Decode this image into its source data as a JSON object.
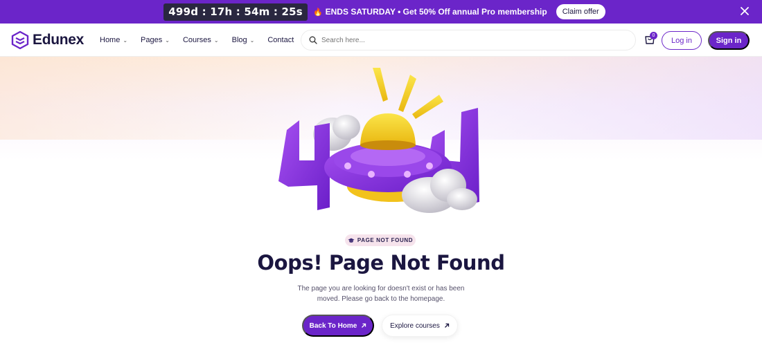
{
  "promo": {
    "countdown": "499d : 17h : 54m : 25s",
    "message": "ENDS SATURDAY • Get 50% Off annual Pro membership",
    "claim_label": "Claim offer"
  },
  "header": {
    "brand": "Edunex",
    "nav": [
      {
        "label": "Home",
        "has_dropdown": true
      },
      {
        "label": "Pages",
        "has_dropdown": true
      },
      {
        "label": "Courses",
        "has_dropdown": true
      },
      {
        "label": "Blog",
        "has_dropdown": true
      },
      {
        "label": "Contact",
        "has_dropdown": false
      }
    ],
    "search_placeholder": "Search here...",
    "cart_count": "0",
    "login_label": "Log in",
    "signin_label": "Sign in"
  },
  "hero": {
    "badge": "PAGE NOT FOUND",
    "title": "Oops! Page Not Found",
    "description": "The page you are looking for doesn't exist or has been moved. Please go back to the homepage.",
    "primary_button": "Back To Home",
    "secondary_button": "Explore courses"
  },
  "colors": {
    "brand_purple": "#6b25c9",
    "dark_text": "#1b1640",
    "countdown_bg": "#2a2740",
    "illustration_yellow": "#f3d02a"
  },
  "icons": [
    "fire-icon",
    "close-icon",
    "logo-icon",
    "chevron-down-icon",
    "search-icon",
    "cart-icon",
    "graduation-cap-icon",
    "arrow-up-right-icon"
  ]
}
